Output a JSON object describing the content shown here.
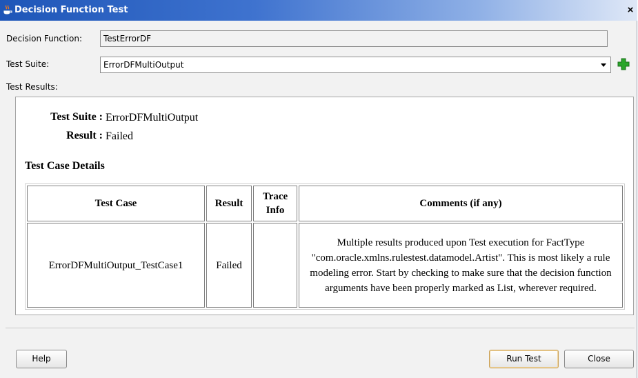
{
  "window": {
    "title": "Decision Function Test",
    "close_glyph": "×"
  },
  "form": {
    "decision_function_label": "Decision Function:",
    "decision_function_value": "TestErrorDF",
    "test_suite_label": "Test Suite:",
    "test_suite_value": "ErrorDFMultiOutput",
    "test_results_label": "Test Results:"
  },
  "results": {
    "suite_label": "Test Suite :",
    "suite_value": "ErrorDFMultiOutput",
    "result_label": "Result :",
    "result_value": "Failed",
    "details_heading": "Test Case Details",
    "columns": [
      "Test Case",
      "Result",
      "Trace Info",
      "Comments (if any)"
    ],
    "rows": [
      {
        "test_case": "ErrorDFMultiOutput_TestCase1",
        "result": "Failed",
        "trace_info": "",
        "comments": "Multiple results produced upon Test execution for FactType \"com.oracle.xmlns.rulestest.datamodel.Artist\". This is most likely a rule modeling error. Start by checking to make sure that the decision function arguments have been properly marked as List, wherever required."
      }
    ]
  },
  "buttons": {
    "help": "Help",
    "run_test": "Run Test",
    "close": "Close"
  },
  "icons": {
    "app": "java-coffee-icon",
    "add": "add-plus-icon",
    "dropdown": "dropdown-arrow-icon"
  },
  "colors": {
    "titlebar_start": "#1e56b8",
    "add_icon": "#2aa52a",
    "default_button_border": "#c9a15a"
  }
}
